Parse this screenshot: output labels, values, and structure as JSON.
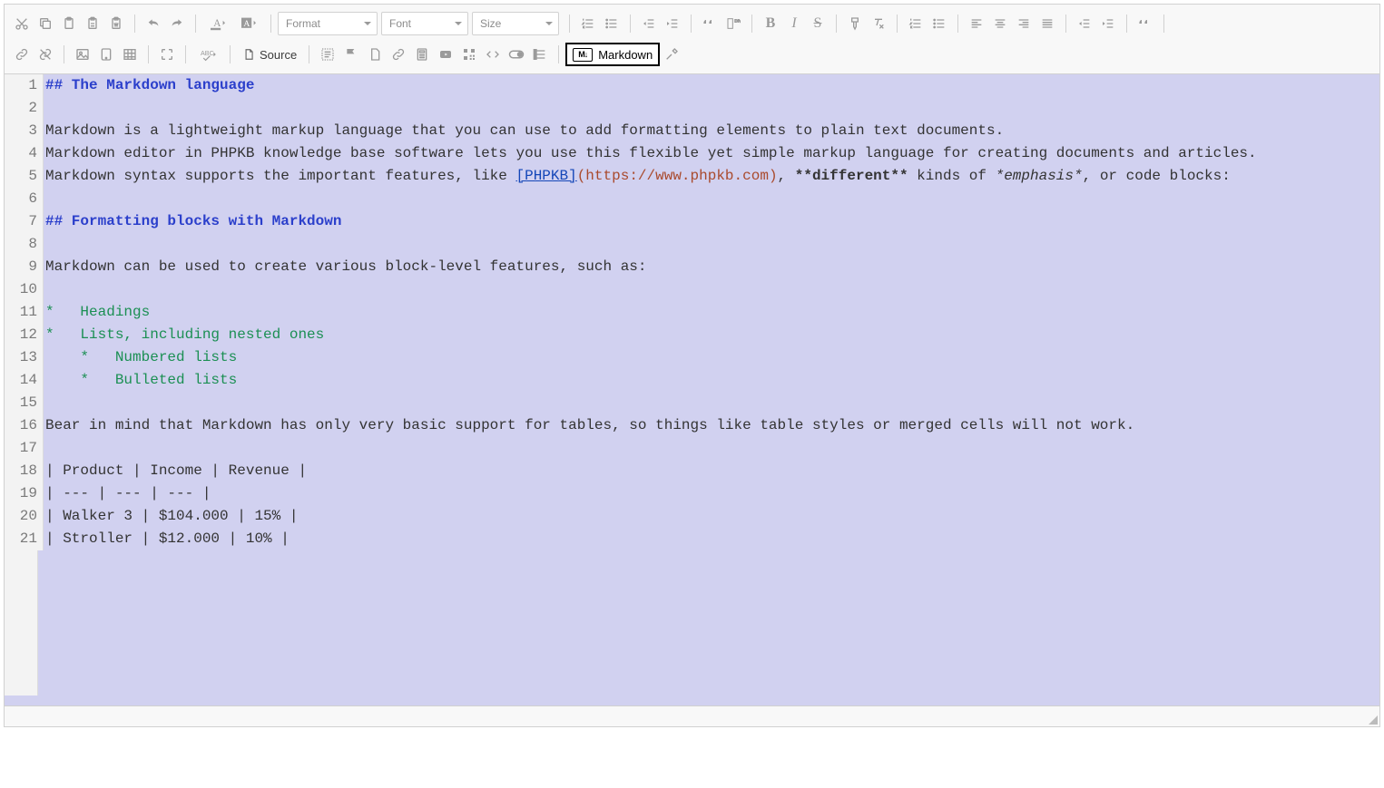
{
  "toolbar": {
    "format_label": "Format",
    "font_label": "Font",
    "size_label": "Size",
    "source_label": "Source",
    "markdown_label": "Markdown",
    "markdown_badge": "M↓"
  },
  "editor": {
    "lines": [
      {
        "n": 1,
        "segments": [
          {
            "cls": "tok-header",
            "text": "## The Markdown language"
          }
        ]
      },
      {
        "n": 2,
        "segments": []
      },
      {
        "n": 3,
        "segments": [
          {
            "cls": "",
            "text": "Markdown is a lightweight markup language that you can use to add formatting elements to plain text documents."
          }
        ]
      },
      {
        "n": 4,
        "segments": [
          {
            "cls": "",
            "text": "Markdown editor in PHPKB knowledge base software lets you use this flexible yet simple markup language for creating documents and articles."
          }
        ]
      },
      {
        "n": 5,
        "segments": [
          {
            "cls": "",
            "text": "Markdown syntax supports the important features, like "
          },
          {
            "cls": "tok-link-label",
            "text": "[PHPKB]"
          },
          {
            "cls": "tok-link-url",
            "text": "(https://www.phpkb.com)"
          },
          {
            "cls": "",
            "text": ", "
          },
          {
            "cls": "tok-strong",
            "text": "**different**"
          },
          {
            "cls": "",
            "text": " kinds of "
          },
          {
            "cls": "tok-em",
            "text": "*emphasis*"
          },
          {
            "cls": "",
            "text": ", or code blocks:"
          }
        ]
      },
      {
        "n": 6,
        "segments": []
      },
      {
        "n": 7,
        "segments": [
          {
            "cls": "tok-header",
            "text": "## Formatting blocks with Markdown"
          }
        ]
      },
      {
        "n": 8,
        "segments": []
      },
      {
        "n": 9,
        "segments": [
          {
            "cls": "",
            "text": "Markdown can be used to create various block-level features, such as:"
          }
        ]
      },
      {
        "n": 10,
        "segments": []
      },
      {
        "n": 11,
        "segments": [
          {
            "cls": "tok-list",
            "text": "*   Headings"
          }
        ]
      },
      {
        "n": 12,
        "segments": [
          {
            "cls": "tok-list",
            "text": "*   Lists, including nested ones"
          }
        ]
      },
      {
        "n": 13,
        "segments": [
          {
            "cls": "tok-list",
            "text": "    *   Numbered lists"
          }
        ]
      },
      {
        "n": 14,
        "segments": [
          {
            "cls": "tok-list",
            "text": "    *   Bulleted lists"
          }
        ]
      },
      {
        "n": 15,
        "segments": []
      },
      {
        "n": 16,
        "segments": [
          {
            "cls": "",
            "text": "Bear in mind that Markdown has only very basic support for tables, so things like table styles or merged cells will not work."
          }
        ]
      },
      {
        "n": 17,
        "segments": []
      },
      {
        "n": 18,
        "segments": [
          {
            "cls": "",
            "text": "| Product | Income | Revenue |"
          }
        ]
      },
      {
        "n": 19,
        "segments": [
          {
            "cls": "",
            "text": "| --- | --- | --- |"
          }
        ]
      },
      {
        "n": 20,
        "segments": [
          {
            "cls": "",
            "text": "| Walker 3 | $104.000 | 15% |"
          }
        ]
      },
      {
        "n": 21,
        "segments": [
          {
            "cls": "",
            "text": "| Stroller | $12.000 | 10% |"
          }
        ]
      }
    ]
  }
}
